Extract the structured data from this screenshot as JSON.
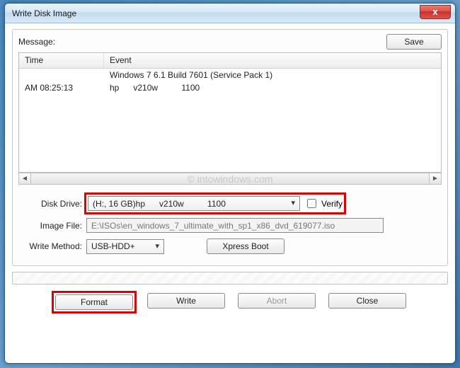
{
  "window": {
    "title": "Write Disk Image"
  },
  "buttons": {
    "close_x": "x",
    "save": "Save",
    "xpress_boot": "Xpress Boot",
    "format": "Format",
    "write": "Write",
    "abort": "Abort",
    "close": "Close"
  },
  "labels": {
    "message": "Message:",
    "time_col": "Time",
    "event_col": "Event",
    "disk_drive": "Disk Drive:",
    "image_file": "Image File:",
    "write_method": "Write Method:",
    "verify": "Verify"
  },
  "log": {
    "rows": [
      {
        "time": "",
        "event": "Windows 7 6.1 Build 7601 (Service Pack 1)"
      },
      {
        "time": "AM 08:25:13",
        "event": "hp      v210w          1100"
      }
    ]
  },
  "fields": {
    "disk_drive": "(H:, 16 GB)hp      v210w          1100",
    "image_file": "E:\\ISOs\\en_windows_7_ultimate_with_sp1_x86_dvd_619077.iso",
    "write_method": "USB-HDD+",
    "verify_checked": false
  },
  "watermark": "© intowindows.com"
}
